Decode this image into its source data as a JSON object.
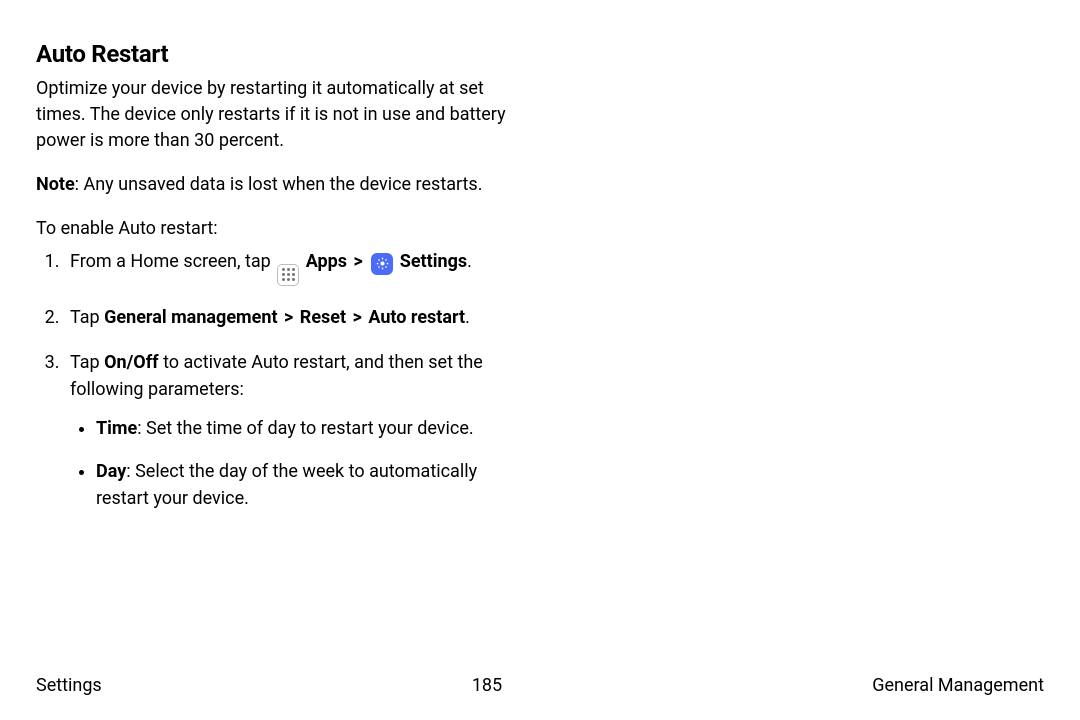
{
  "title": "Auto Restart",
  "intro": "Optimize your device by restarting it automatically at set times. The device only restarts if it is not in use and battery power is more than 30 percent.",
  "note_label": "Note",
  "note_body": ": Any unsaved data is lost when the device restarts.",
  "enable_lead": "To enable Auto restart:",
  "step1_pre": "From a Home screen, tap ",
  "apps_label": "Apps",
  "sep": ">",
  "settings_label": "Settings",
  "step1_post": ".",
  "step2_pre": "Tap ",
  "step2_path1": "General management",
  "step2_path2": "Reset",
  "step2_path3": "Auto restart",
  "step2_post": ".",
  "step3_pre": "Tap ",
  "step3_onoff": "On/Off",
  "step3_post": " to activate Auto restart, and then set the following parameters:",
  "bullet_time_label": "Time",
  "bullet_time_body": ": Set the time of day to restart your device.",
  "bullet_day_label": "Day",
  "bullet_day_body": ": Select the day of the week to automatically restart your device.",
  "footer": {
    "left": "Settings",
    "center": "185",
    "right": "General Management"
  }
}
